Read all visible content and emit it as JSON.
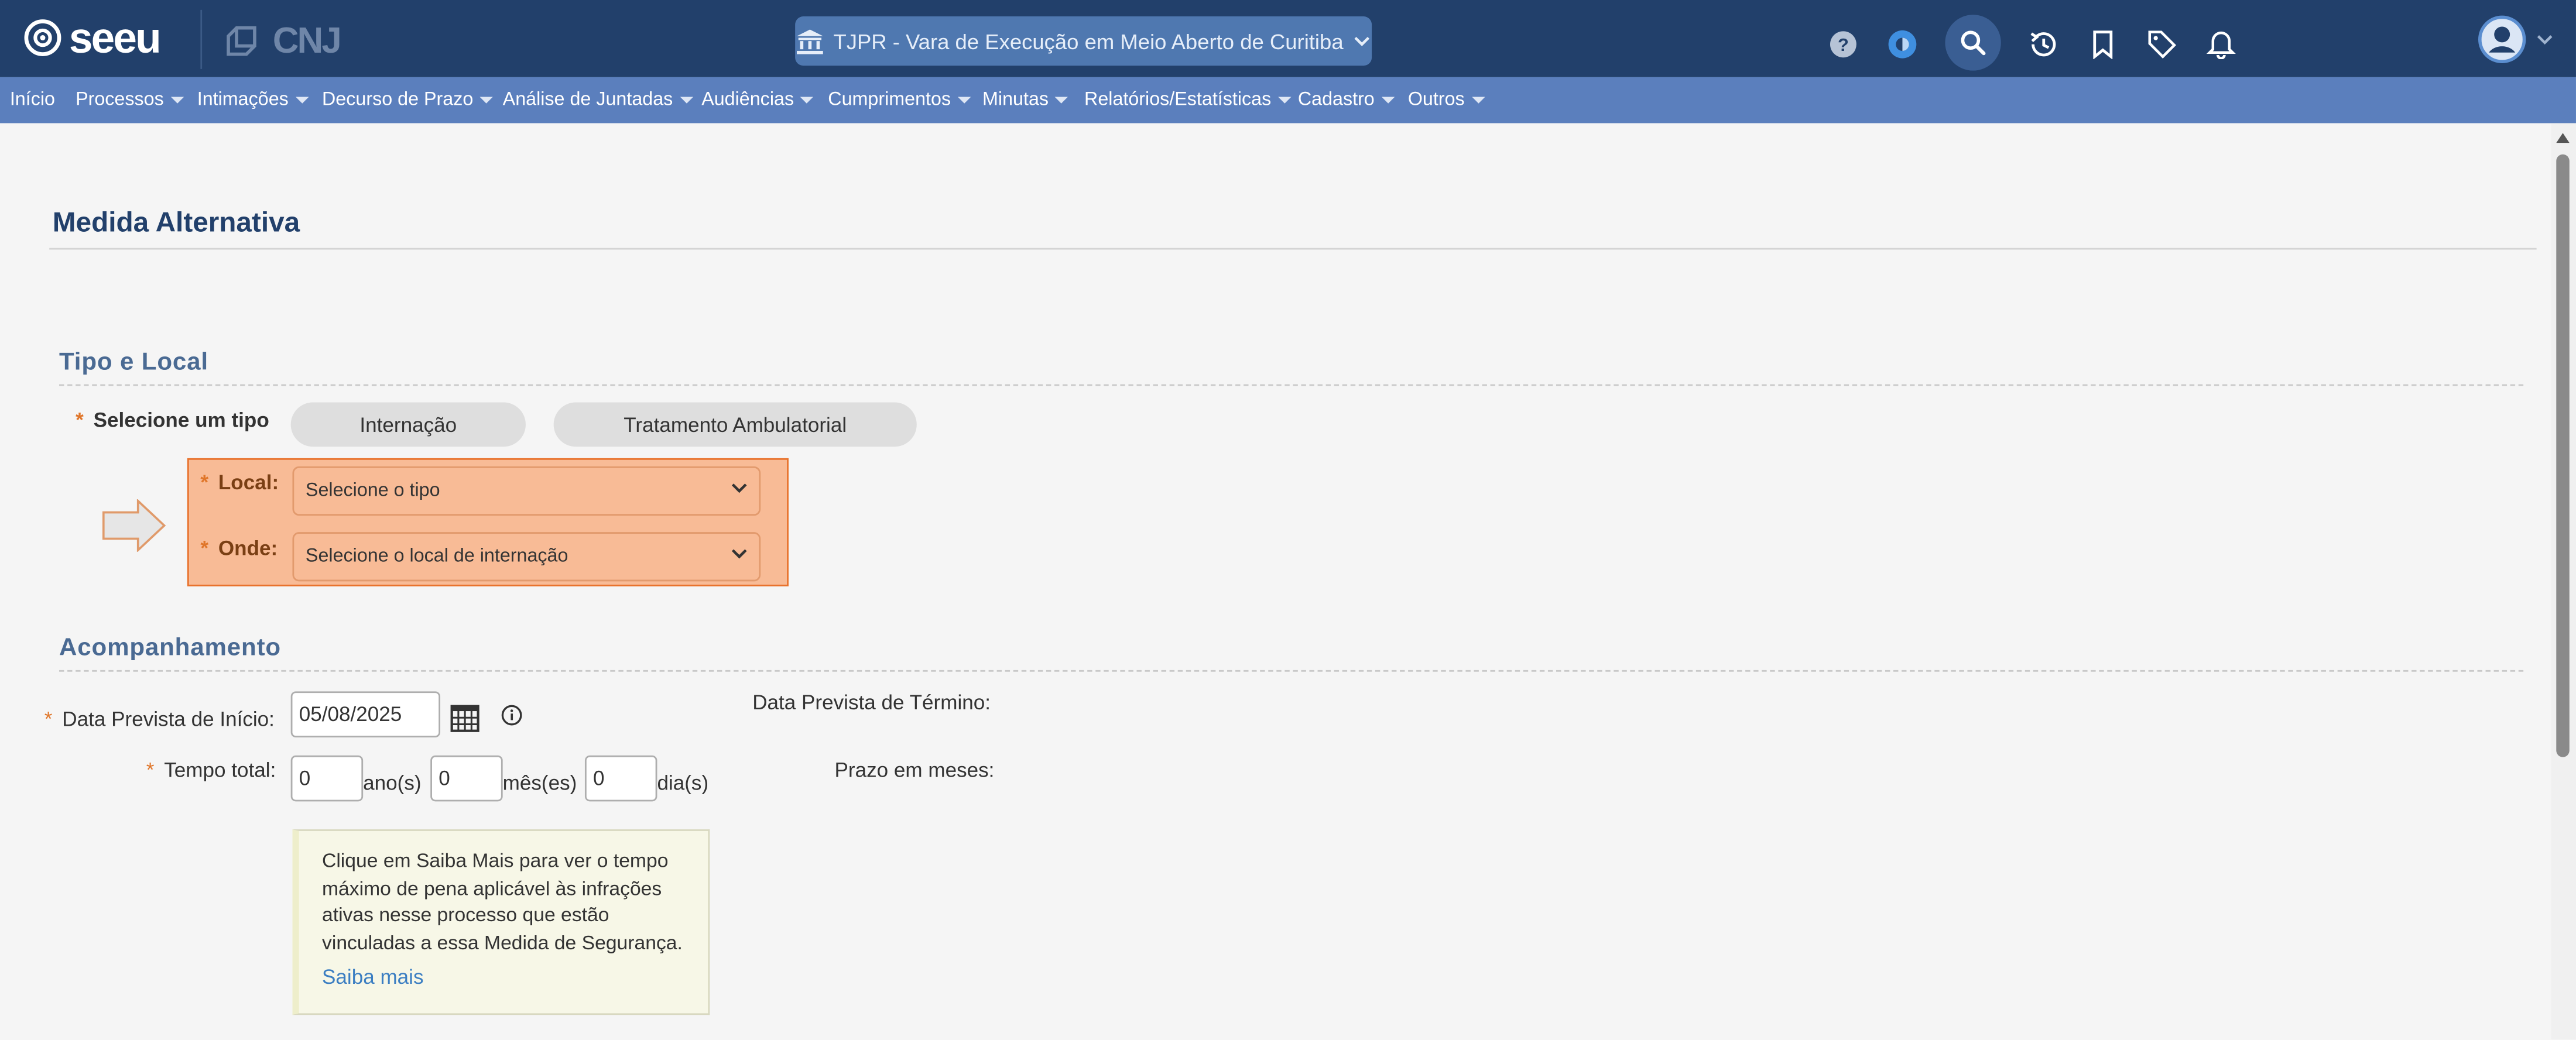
{
  "header": {
    "logo_text": "seeu",
    "cnj_text": "CNJ",
    "court_selector": "TJPR - Vara de Execução em Meio Aberto de Curitiba",
    "icons": [
      "help-icon",
      "theme-icon",
      "search-icon",
      "history-icon",
      "bookmark-icon",
      "tag-icon",
      "bell-icon",
      "user-icon"
    ]
  },
  "nav": {
    "items": [
      {
        "label": "Início",
        "has_caret": false
      },
      {
        "label": "Processos",
        "has_caret": true
      },
      {
        "label": "Intimações",
        "has_caret": true
      },
      {
        "label": "Decurso de Prazo",
        "has_caret": true
      },
      {
        "label": "Análise de Juntadas",
        "has_caret": true
      },
      {
        "label": "Audiências",
        "has_caret": true
      },
      {
        "label": "Cumprimentos",
        "has_caret": true
      },
      {
        "label": "Minutas",
        "has_caret": true
      },
      {
        "label": "Relatórios/Estatísticas",
        "has_caret": true
      },
      {
        "label": "Cadastro",
        "has_caret": true
      },
      {
        "label": "Outros",
        "has_caret": true
      }
    ]
  },
  "page": {
    "title": "Medida Alternativa"
  },
  "tipo_local": {
    "section_title": "Tipo e Local",
    "required_mark": "*",
    "select_type_label": "Selecione um tipo",
    "type_buttons": [
      "Internação",
      "Tratamento Ambulatorial"
    ],
    "local_label": "Local:",
    "local_value": "Selecione o tipo",
    "onde_label": "Onde:",
    "onde_value": "Selecione o local de internação"
  },
  "acompanhamento": {
    "section_title": "Acompanhamento",
    "start_date_label": "Data Prevista de Início:",
    "start_date_value": "05/08/2025",
    "end_date_label": "Data Prevista de Término:",
    "total_time_label": "Tempo total:",
    "years_value": "0",
    "years_unit": "ano(s)",
    "months_value": "0",
    "months_unit": "mês(es)",
    "days_value": "0",
    "days_unit": "dia(s)",
    "months_term_label": "Prazo em meses:",
    "info_text": "Clique em Saiba Mais para ver o tempo máximo de pena aplicável às infrações ativas nesse processo que estão vinculadas a essa Medida de Segurança.",
    "info_link": "Saiba mais"
  },
  "colors": {
    "topbar": "#22406b",
    "navbar": "#5b7fbd",
    "highlight": "#f8bb96",
    "highlight_border": "#e8722c",
    "required": "#e0762a",
    "link": "#3b7ec2"
  }
}
